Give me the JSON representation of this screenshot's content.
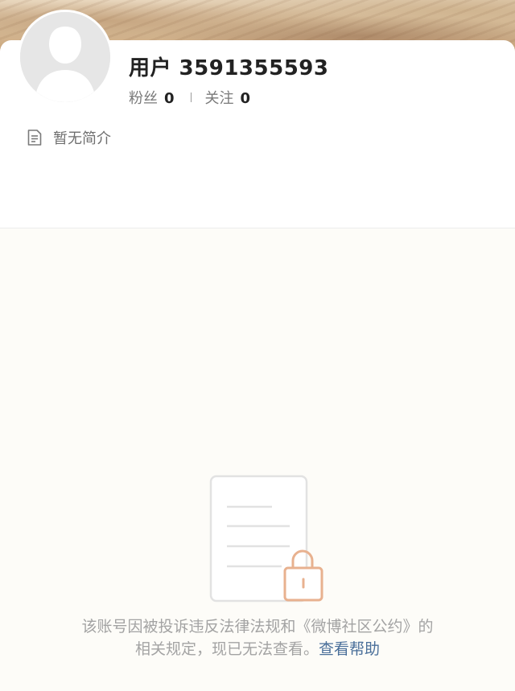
{
  "profile": {
    "username": "用户 3591355593",
    "followers_label": "粉丝",
    "followers_count": "0",
    "following_label": "关注",
    "following_count": "0",
    "bio": "暂无简介"
  },
  "notice": {
    "line1": "该账号因被投诉违反法律法规和《微博社区公约》的",
    "line2_prefix": "相关规定，现已无法查看。",
    "help_link": "查看帮助"
  },
  "icons": {
    "avatar": "default-avatar-icon",
    "bio": "document-icon",
    "empty_state": "locked-document-icon"
  },
  "colors": {
    "link": "#4a6f9a",
    "muted_text": "#a3a3a3",
    "illustration": "#e8b18f"
  }
}
